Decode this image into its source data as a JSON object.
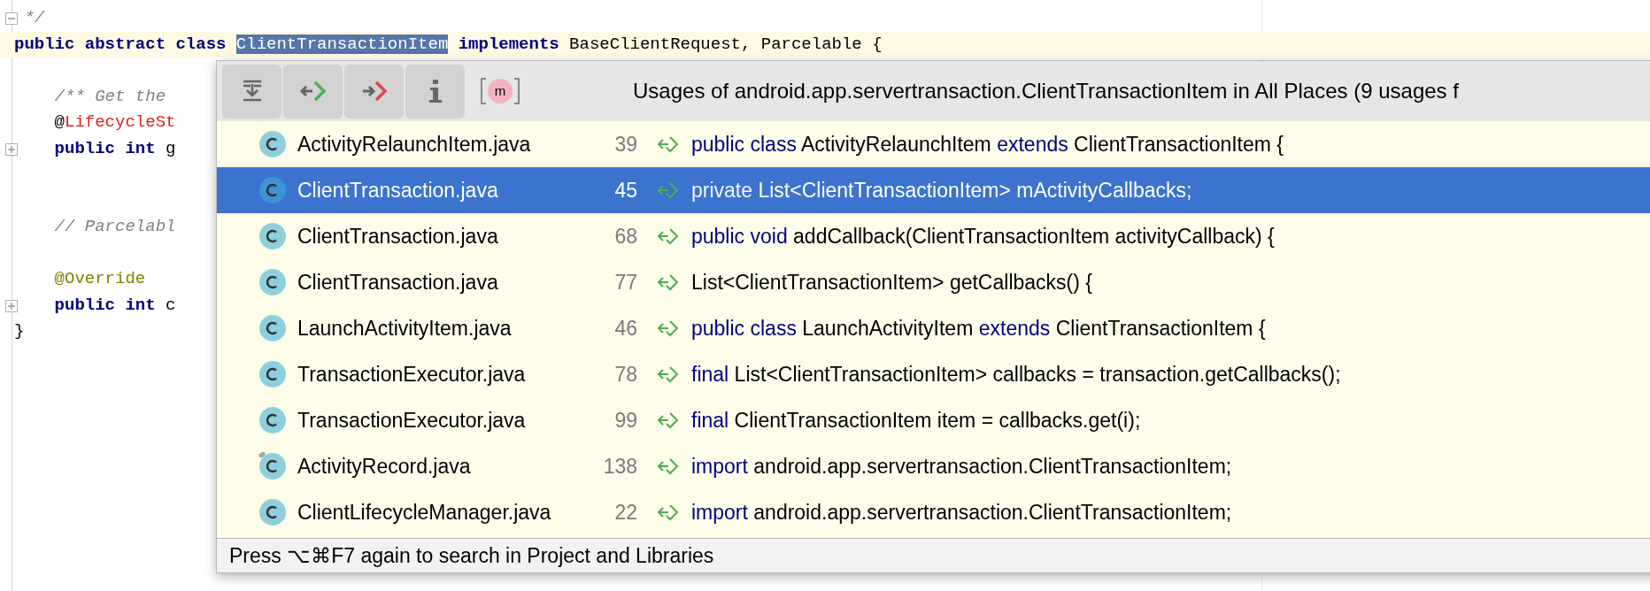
{
  "editor": {
    "lines": [
      {
        "kind": "fold-open",
        "current": false,
        "segments": [
          {
            "kind": "comment",
            "text": " */"
          }
        ]
      },
      {
        "kind": "code",
        "current": true,
        "segments": [
          {
            "kind": "keyword",
            "text": "public abstract class "
          },
          {
            "kind": "selection",
            "text": "ClientTransactionItem"
          },
          {
            "kind": "keyword",
            "text": " implements"
          },
          {
            "kind": "plain",
            "text": " BaseClientRequest, Parcelable {"
          }
        ]
      },
      {
        "kind": "blank"
      },
      {
        "kind": "code",
        "current": false,
        "segments": [
          {
            "kind": "comment",
            "text": "    /** Get the"
          }
        ]
      },
      {
        "kind": "code",
        "current": false,
        "segments": [
          {
            "kind": "plain",
            "text": "    @"
          },
          {
            "kind": "annotation-name",
            "text": "LifecycleSt"
          }
        ]
      },
      {
        "kind": "fold-closed",
        "current": false,
        "segments": [
          {
            "kind": "keyword",
            "text": "    public int "
          },
          {
            "kind": "plain",
            "text": "g"
          }
        ]
      },
      {
        "kind": "blank"
      },
      {
        "kind": "blank"
      },
      {
        "kind": "code",
        "current": false,
        "segments": [
          {
            "kind": "comment",
            "text": "    // Parcelabl"
          }
        ]
      },
      {
        "kind": "blank"
      },
      {
        "kind": "code",
        "current": false,
        "segments": [
          {
            "kind": "annotation",
            "text": "    @Override"
          }
        ]
      },
      {
        "kind": "fold-closed",
        "current": false,
        "segments": [
          {
            "kind": "keyword",
            "text": "    public int "
          },
          {
            "kind": "plain",
            "text": "c"
          }
        ]
      },
      {
        "kind": "code",
        "current": false,
        "segments": [
          {
            "kind": "plain",
            "text": "}"
          }
        ]
      }
    ]
  },
  "popup": {
    "toolbar": [
      {
        "kind": "pin"
      },
      {
        "kind": "previous"
      },
      {
        "kind": "next"
      },
      {
        "kind": "info"
      }
    ],
    "filter": {
      "label": "m",
      "on": true
    },
    "title": "Usages of android.app.servertransaction.ClientTransactionItem in All Places (9 usages f",
    "rows": [
      {
        "file": "ActivityRelaunchItem.java",
        "line": "39",
        "selected": false,
        "decorated": false,
        "code": [
          {
            "kind": "keyword",
            "text": "public class "
          },
          {
            "kind": "plain",
            "text": "ActivityRelaunchItem "
          },
          {
            "kind": "keyword",
            "text": "extends "
          },
          {
            "kind": "plain",
            "text": "ClientTransactionItem {"
          }
        ]
      },
      {
        "file": "ClientTransaction.java",
        "line": "45",
        "selected": true,
        "decorated": false,
        "code": [
          {
            "kind": "keyword",
            "text": "private "
          },
          {
            "kind": "plain",
            "text": "List<ClientTransactionItem> mActivityCallbacks;"
          }
        ]
      },
      {
        "file": "ClientTransaction.java",
        "line": "68",
        "selected": false,
        "decorated": false,
        "code": [
          {
            "kind": "keyword",
            "text": "public void "
          },
          {
            "kind": "plain",
            "text": "addCallback(ClientTransactionItem activityCallback) {"
          }
        ]
      },
      {
        "file": "ClientTransaction.java",
        "line": "77",
        "selected": false,
        "decorated": false,
        "code": [
          {
            "kind": "plain",
            "text": "List<ClientTransactionItem> getCallbacks() {"
          }
        ]
      },
      {
        "file": "LaunchActivityItem.java",
        "line": "46",
        "selected": false,
        "decorated": false,
        "code": [
          {
            "kind": "keyword",
            "text": "public class "
          },
          {
            "kind": "plain",
            "text": "LaunchActivityItem "
          },
          {
            "kind": "keyword",
            "text": "extends "
          },
          {
            "kind": "plain",
            "text": "ClientTransactionItem {"
          }
        ]
      },
      {
        "file": "TransactionExecutor.java",
        "line": "78",
        "selected": false,
        "decorated": false,
        "code": [
          {
            "kind": "keyword",
            "text": "final "
          },
          {
            "kind": "plain",
            "text": "List<ClientTransactionItem> callbacks = transaction.getCallbacks();"
          }
        ]
      },
      {
        "file": "TransactionExecutor.java",
        "line": "99",
        "selected": false,
        "decorated": false,
        "code": [
          {
            "kind": "keyword",
            "text": "final "
          },
          {
            "kind": "plain",
            "text": "ClientTransactionItem item = callbacks.get(i);"
          }
        ]
      },
      {
        "file": "ActivityRecord.java",
        "line": "138",
        "selected": false,
        "decorated": true,
        "code": [
          {
            "kind": "keyword",
            "text": "import "
          },
          {
            "kind": "plain",
            "text": "android.app.servertransaction.ClientTransactionItem;"
          }
        ]
      },
      {
        "file": "ClientLifecycleManager.java",
        "line": "22",
        "selected": false,
        "decorated": false,
        "code": [
          {
            "kind": "keyword",
            "text": "import "
          },
          {
            "kind": "plain",
            "text": "android.app.servertransaction.ClientTransactionItem;"
          }
        ]
      }
    ],
    "footer": "Press ⌥⌘F7 again to search in Project and Libraries"
  }
}
